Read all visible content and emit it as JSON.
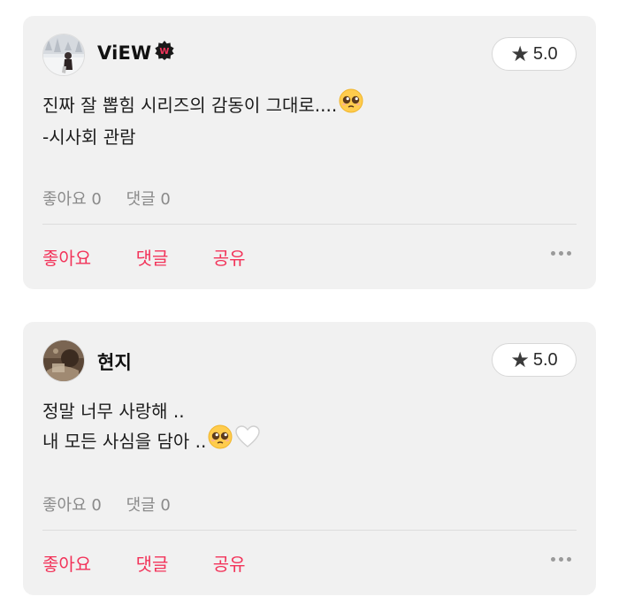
{
  "reviews": [
    {
      "username": "ViEW",
      "rating": "5.0",
      "text_lines": [
        "진짜 잘 뽑힘 시리즈의 감동이 그대로....",
        "-시사회 관람"
      ],
      "likes_stat": "좋아요 0",
      "comments_stat": "댓글 0",
      "actions": {
        "like": "좋아요",
        "comment": "댓글",
        "share": "공유"
      },
      "badge_letter": "W"
    },
    {
      "username": "현지",
      "rating": "5.0",
      "text_lines": [
        "정말 너무 사랑해 ..",
        "내 모든 사심을 담아 .."
      ],
      "likes_stat": "좋아요 0",
      "comments_stat": "댓글 0",
      "actions": {
        "like": "좋아요",
        "comment": "댓글",
        "share": "공유"
      }
    }
  ],
  "colors": {
    "accent": "#f2345a",
    "card_bg": "#f1f1f1",
    "stat_text": "#8a8a8a"
  },
  "icons": {
    "rating": "star-icon",
    "more": "more-dots-icon",
    "emoji": "pleading-face-emoji",
    "heart": "white-heart-emoji"
  }
}
